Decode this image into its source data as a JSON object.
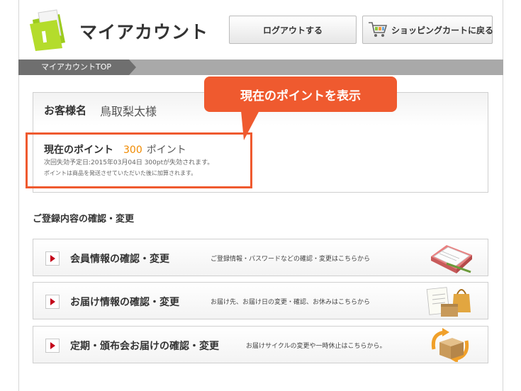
{
  "header": {
    "title": "マイアカウント",
    "logout_label": "ログアウトする",
    "cart_label": "ショッピングカートに戻る"
  },
  "breadcrumb": {
    "current": "マイアカウントTOP"
  },
  "account": {
    "customer_label": "お客様名",
    "customer_name": "鳥取梨太様",
    "points_label": "現在のポイント",
    "points_value": "300",
    "points_unit": "ポイント",
    "expire_note": "次回失効予定日:2015年03月04日 300ptが失効されます。",
    "points_note": "ポイントは商品を発送させていただいた後に加算されます。"
  },
  "annotation": {
    "callout": "現在のポイントを表示"
  },
  "section": {
    "title": "ご登録内容の確認・変更"
  },
  "menu": [
    {
      "label": "会員情報の確認・変更",
      "desc": "ご登録情報・パスワードなどの確認・変更はこちらから",
      "icon": "notebook-icon"
    },
    {
      "label": "お届け情報の確認・変更",
      "desc": "お届け先、お届け日の変更・確認、お休みはこちらから",
      "icon": "delivery-box-icon"
    },
    {
      "label": "定期・頒布会お届けの確認・変更",
      "desc": "お届けサイクルの変更や一時休止はこちらから。",
      "icon": "recurring-box-icon"
    }
  ],
  "colors": {
    "accent": "#ef5a2f",
    "points": "#f08a00",
    "arrow": "#c4001a",
    "breadcrumb": "#6f6f6f"
  }
}
